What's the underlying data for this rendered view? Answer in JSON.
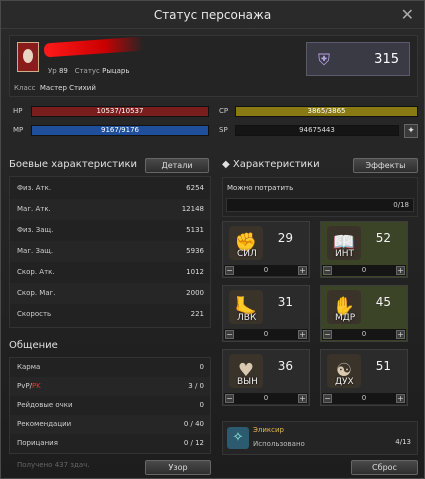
{
  "window": {
    "title": "Статус персонажа"
  },
  "profile": {
    "level_label": "Ур",
    "level": "89",
    "status_label": "Статус",
    "status": "Рыцарь",
    "class_label": "Класс",
    "class": "Мастер Стихий",
    "fame": "315"
  },
  "bars": {
    "hp_label": "HP",
    "hp": "10537/10537",
    "hp_fill": 1.0,
    "mp_label": "MP",
    "mp": "9167/9176",
    "mp_fill": 0.999,
    "cp_label": "CP",
    "cp": "3865/3865",
    "cp_fill": 1.0,
    "sp_label": "SP",
    "sp": "94675443"
  },
  "combat": {
    "title": "Боевые характеристики",
    "details_button": "Детали",
    "rows": [
      {
        "k": "Физ. Атк.",
        "v": "6254"
      },
      {
        "k": "Маг. Атк.",
        "v": "12148"
      },
      {
        "k": "Физ. Защ.",
        "v": "5131"
      },
      {
        "k": "Маг. Защ.",
        "v": "5936"
      },
      {
        "k": "Скор. Атк.",
        "v": "1012"
      },
      {
        "k": "Скор. Маг.",
        "v": "2000"
      },
      {
        "k": "Скорость",
        "v": "221"
      }
    ]
  },
  "social": {
    "title": "Общение",
    "rows": [
      {
        "k": "Карма",
        "v": "0"
      },
      {
        "k_pre": "PvP/",
        "k_pk": "PK",
        "v": "3 / 0"
      },
      {
        "k": "Рейдовые очки",
        "v": "0"
      },
      {
        "k": "Рекомендации",
        "v": "0 / 40"
      },
      {
        "k": "Порицания",
        "v": "0 / 12"
      }
    ]
  },
  "stats": {
    "title": "Характеристики",
    "effects_button": "Эффекты",
    "can_spend_label": "Можно потратить",
    "can_spend": "0/18",
    "cells": [
      {
        "name": "СИЛ",
        "value": "29",
        "points": "0"
      },
      {
        "name": "ИНТ",
        "value": "52",
        "points": "0"
      },
      {
        "name": "ЛВК",
        "value": "31",
        "points": "0"
      },
      {
        "name": "МДР",
        "value": "45",
        "points": "0"
      },
      {
        "name": "ВЫН",
        "value": "36",
        "points": "0"
      },
      {
        "name": "ДУХ",
        "value": "51",
        "points": "0"
      }
    ]
  },
  "elixir": {
    "title": "Эликсир",
    "used_label": "Использовано",
    "used": "4/13"
  },
  "footer": {
    "view_button": "Узор",
    "reset_button": "Сброс",
    "ghost_text": "Получено 437 здач."
  }
}
